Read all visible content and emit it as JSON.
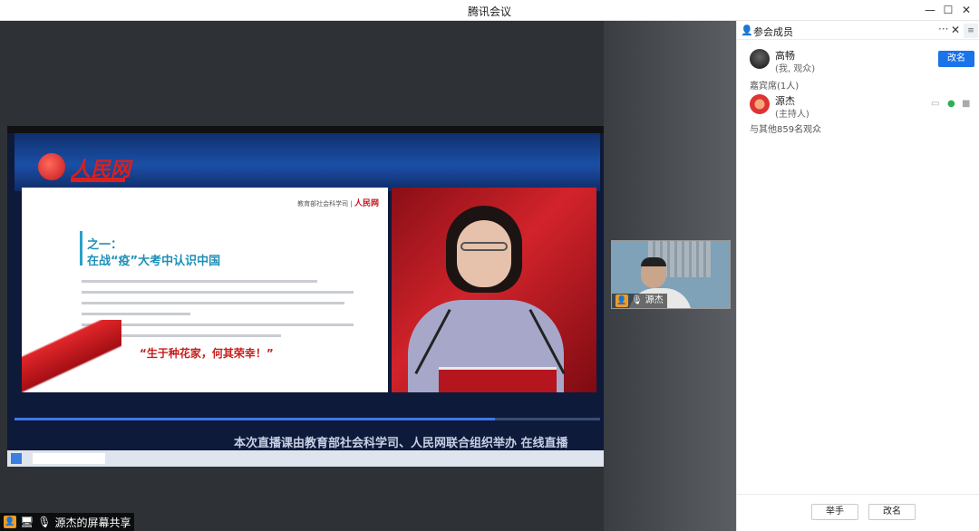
{
  "window": {
    "title": "腾讯会议",
    "controls": {
      "minimize": "—",
      "maximize": "☐",
      "close": "✕"
    }
  },
  "share": {
    "slide": {
      "header": "教育部社会科学司",
      "header_brand": "人民网",
      "heading_line1": "之一：",
      "heading_line2": "在战“疫”大考中认识中国",
      "quote": "“生于种花家，何其荣幸！”"
    },
    "banner_logo": "人民网",
    "ticker": "本次直播课由教育部社会科学司、人民网联合组织举办 在线直播",
    "progress_percent": 82
  },
  "thumbnail": {
    "name": "源杰"
  },
  "share_status": {
    "label": "源杰的屏幕共享"
  },
  "panel": {
    "title": "参会成员",
    "more": "···",
    "close": "✕",
    "menu": "≡",
    "me": {
      "name": "高畅",
      "status": "(我, 观众)",
      "rename_label": "改名"
    },
    "guest_section": "嘉宾席(1人)",
    "host": {
      "name": "源杰",
      "role": "(主持人)"
    },
    "audience_summary": "与其他859名观众",
    "footer": {
      "raise_hand": "举手",
      "rename": "改名"
    }
  },
  "colors": {
    "accent": "#1a73e8",
    "stage_bg": "#2e3136",
    "share_badge": "#f39a24"
  }
}
